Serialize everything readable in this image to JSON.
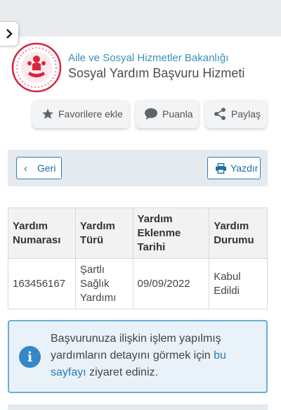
{
  "header": {
    "ministry": "Aile ve Sosyal Hizmetler Bakanlığı",
    "service": "Sosyal Yardım Başvuru Hizmeti"
  },
  "actions": {
    "favorite": "Favorilere ekle",
    "rate": "Puanla",
    "share": "Paylaş"
  },
  "toolbar": {
    "back": "Geri",
    "print": "Yazdır"
  },
  "table": {
    "headers": [
      "Yardım Numarası",
      "Yardım Türü",
      "Yardım Eklenme Tarihi",
      "Yardım Durumu"
    ],
    "rows": [
      [
        "163456167",
        "Şartlı Sağlık Yardımı",
        "09/09/2022",
        "Kabul Edildi"
      ]
    ]
  },
  "info": {
    "text_before": "Başvurunuza ilişkin işlem yapılmış yardımların detayını görmek için ",
    "link": "bu sayfayı",
    "text_after": " ziyaret ediniz."
  },
  "colors": {
    "accent": "#2f7db3",
    "info_bg": "#e9f2f8",
    "logo_red": "#d7263d"
  },
  "icons": [
    "chevron-right-icon",
    "star-icon",
    "speech-bubble-icon",
    "share-icon",
    "chevron-left-icon",
    "printer-icon",
    "info-icon"
  ]
}
